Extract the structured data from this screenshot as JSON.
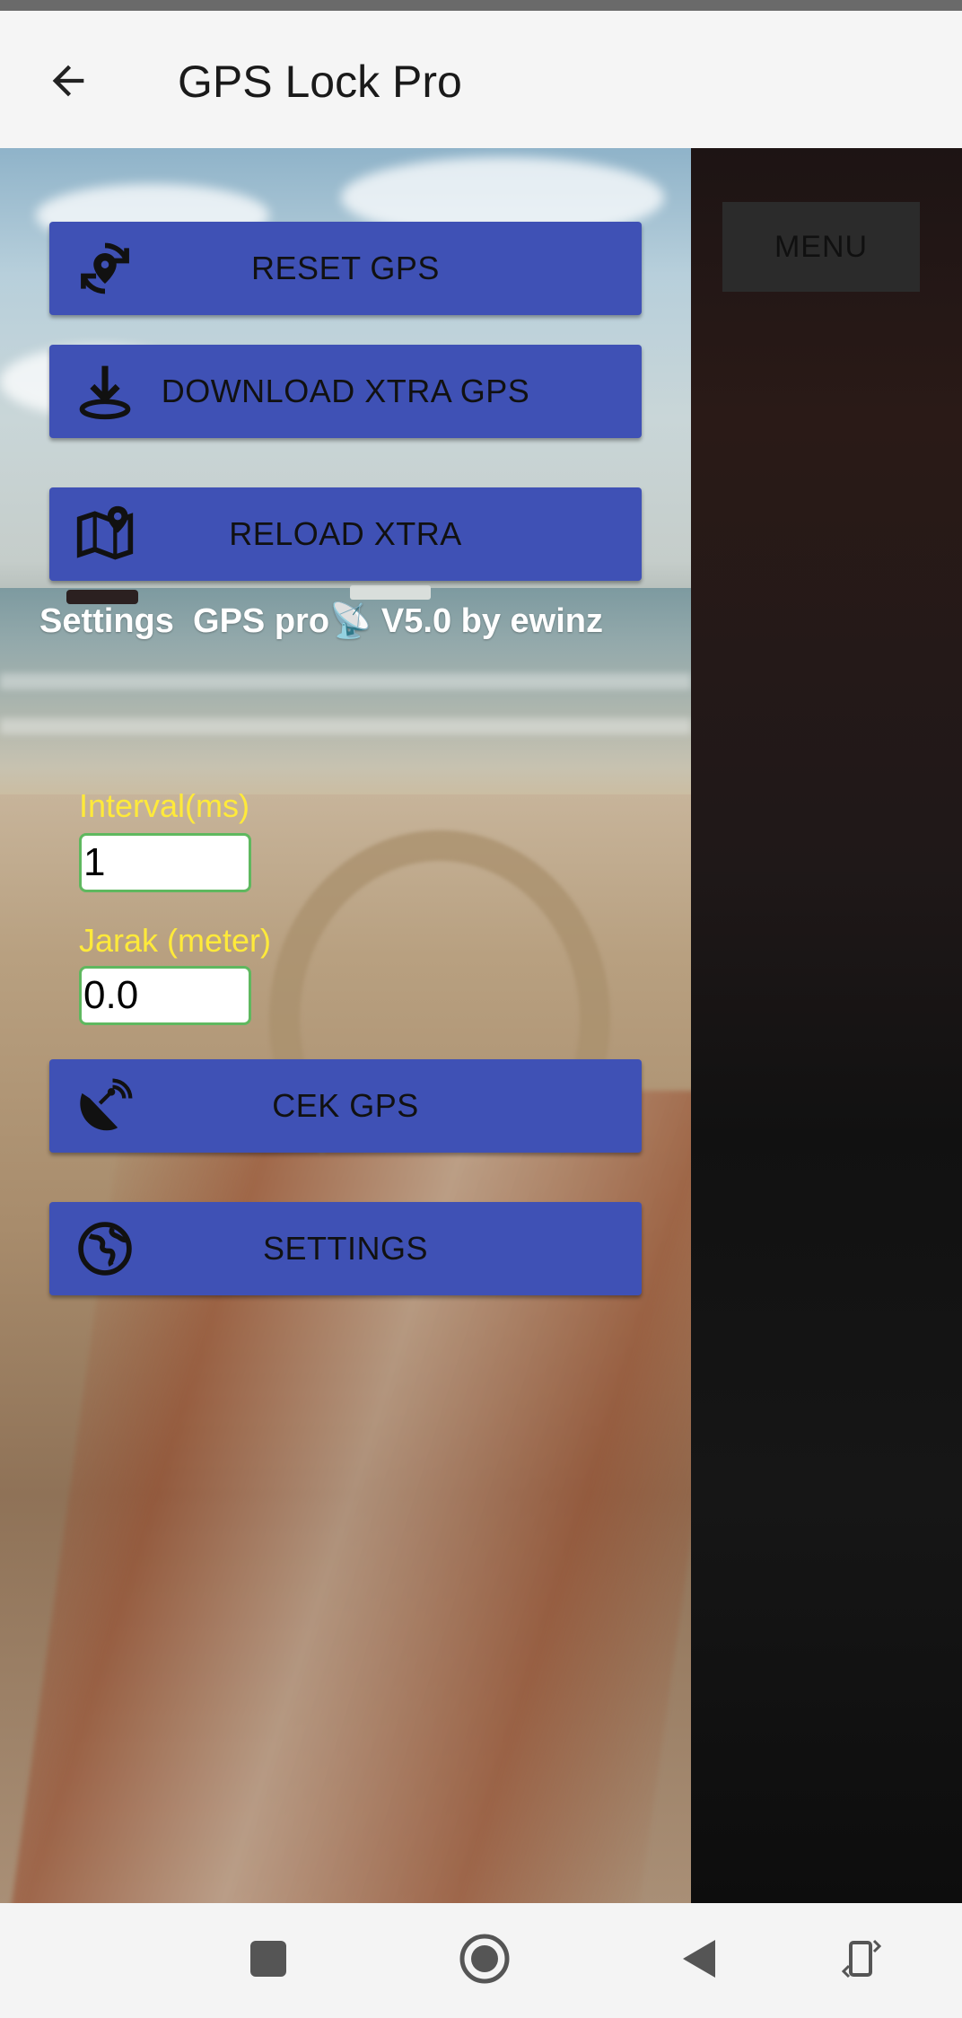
{
  "app_bar": {
    "title": "GPS Lock Pro",
    "back_icon": "arrow-left-icon"
  },
  "drawer": {
    "buttons": [
      {
        "label": "RESET GPS",
        "icon": "gps-reset-icon"
      },
      {
        "label": "DOWNLOAD XTRA GPS",
        "icon": "download-icon"
      },
      {
        "label": "RELOAD XTRA",
        "icon": "map-pin-icon"
      },
      {
        "label": "CEK GPS",
        "icon": "satellite-dish-icon"
      },
      {
        "label": "SETTINGS",
        "icon": "globe-icon"
      }
    ],
    "settings_line": "Settings  GPS pro📡 V5.0 by ewinz",
    "interval": {
      "label": "Interval(ms)",
      "value": "1"
    },
    "jarak": {
      "label": "Jarak (meter)",
      "value": "0.0"
    }
  },
  "right_panel": {
    "menu_label": "MENU"
  },
  "colors": {
    "button": "#3f51b5",
    "field_label": "#ffea3a",
    "field_border": "#5fb85f"
  },
  "nav_bar": {
    "icons": [
      "square-icon",
      "home-circle-icon",
      "back-triangle-icon",
      "rotate-icon"
    ]
  }
}
